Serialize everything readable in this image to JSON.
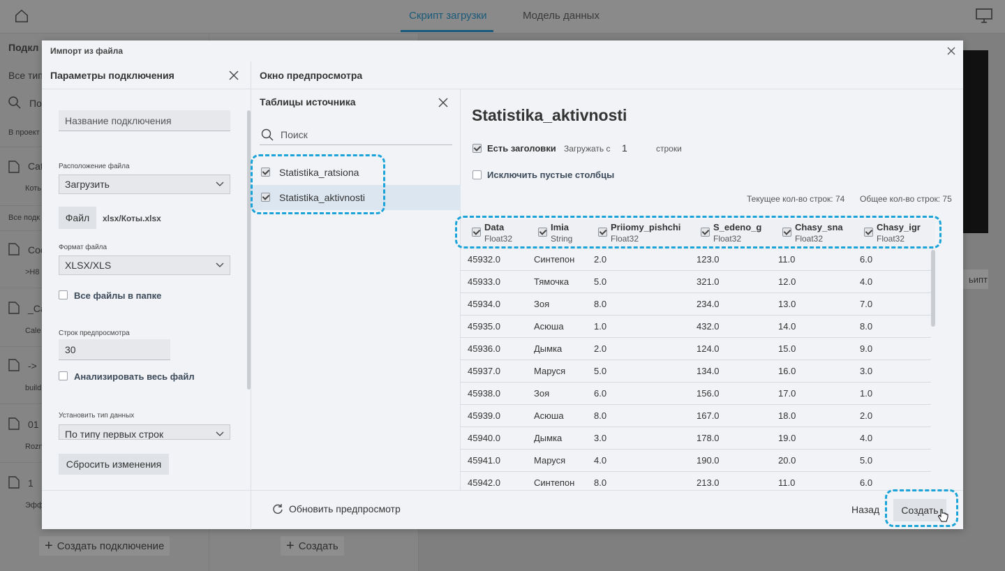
{
  "background": {
    "tabs": [
      "Скрипт загрузки",
      "Модель данных"
    ],
    "left_panel": {
      "title": "Подкл",
      "filter": "Все тип",
      "search": "По",
      "group1": "В проект",
      "items": [
        {
          "name": "Cat",
          "sub": "Коть"
        },
        {
          "name": "Coo",
          "sub": ">H8"
        },
        {
          "name": "_Ca",
          "sub": "Cale"
        },
        {
          "name": "->",
          "sub": "build"
        },
        {
          "name": "01",
          "sub": "Rozn"
        },
        {
          "name": "1",
          "sub": "Эфф"
        }
      ],
      "group2": "Все подк",
      "create_connection": "Создать подключение"
    },
    "mid_create": "Создать",
    "right_script_btn": "ьипт"
  },
  "modal": {
    "title": "Импорт из файла",
    "left": {
      "heading": "Параметры подключения",
      "connection_name_placeholder": "Название подключения",
      "file_location_label": "Расположение файла",
      "file_location_value": "Загрузить",
      "file_button": "Файл",
      "file_name": "xlsx/Коты.xlsx",
      "file_format_label": "Формат файла",
      "file_format_value": "XLSX/XLS",
      "all_files_label": "Все файлы в папке",
      "preview_rows_label": "Строк предпросмотра",
      "preview_rows_value": "30",
      "analyze_label": "Анализировать весь файл",
      "data_type_label": "Установить тип данных",
      "data_type_value": "По типу первых строк",
      "reset_button": "Сбросить изменения"
    },
    "preview": {
      "heading": "Окно предпросмотра",
      "source_tables_heading": "Таблицы источника",
      "search_placeholder": "Поиск",
      "tables": [
        "Statistika_ratsiona",
        "Statistika_aktivnosti"
      ],
      "selected_table": "Statistika_aktivnosti",
      "has_headers_label": "Есть заголовки",
      "load_from_label": "Загружать с",
      "load_from_value": "1",
      "rows_word": "строки",
      "exclude_empty_label": "Исключить пустые столбцы",
      "current_rows": "Текущее кол-во строк: 74",
      "total_rows": "Общее кол-во строк: 75",
      "columns": [
        {
          "name": "Data",
          "type": "Float32"
        },
        {
          "name": "Imia",
          "type": "String"
        },
        {
          "name": "Priiomy_pishchi",
          "type": "Float32"
        },
        {
          "name": "S_edeno_g",
          "type": "Float32"
        },
        {
          "name": "Chasy_sna",
          "type": "Float32"
        },
        {
          "name": "Chasy_igr",
          "type": "Float32"
        }
      ],
      "rows": [
        [
          "45932.0",
          "Синтепон",
          "2.0",
          "123.0",
          "11.0",
          "6.0"
        ],
        [
          "45933.0",
          "Тямочка",
          "5.0",
          "321.0",
          "12.0",
          "4.0"
        ],
        [
          "45934.0",
          "Зоя",
          "8.0",
          "234.0",
          "13.0",
          "7.0"
        ],
        [
          "45935.0",
          "Асюша",
          "1.0",
          "432.0",
          "14.0",
          "8.0"
        ],
        [
          "45936.0",
          "Дымка",
          "2.0",
          "124.0",
          "15.0",
          "9.0"
        ],
        [
          "45937.0",
          "Маруся",
          "5.0",
          "134.0",
          "16.0",
          "3.0"
        ],
        [
          "45938.0",
          "Зоя",
          "6.0",
          "156.0",
          "17.0",
          "1.0"
        ],
        [
          "45939.0",
          "Асюша",
          "8.0",
          "167.0",
          "18.0",
          "2.0"
        ],
        [
          "45940.0",
          "Дымка",
          "3.0",
          "178.0",
          "19.0",
          "4.0"
        ],
        [
          "45941.0",
          "Маруся",
          "4.0",
          "190.0",
          "20.0",
          "5.0"
        ],
        [
          "45942.0",
          "Синтепон",
          "8.0",
          "213.0",
          "11.0",
          "6.0"
        ]
      ]
    },
    "footer": {
      "refresh": "Обновить предпросмотр",
      "back": "Назад",
      "create": "Создать"
    }
  },
  "colors": {
    "highlight": "#19a3d9",
    "selected_row": "#dbe6f1"
  }
}
